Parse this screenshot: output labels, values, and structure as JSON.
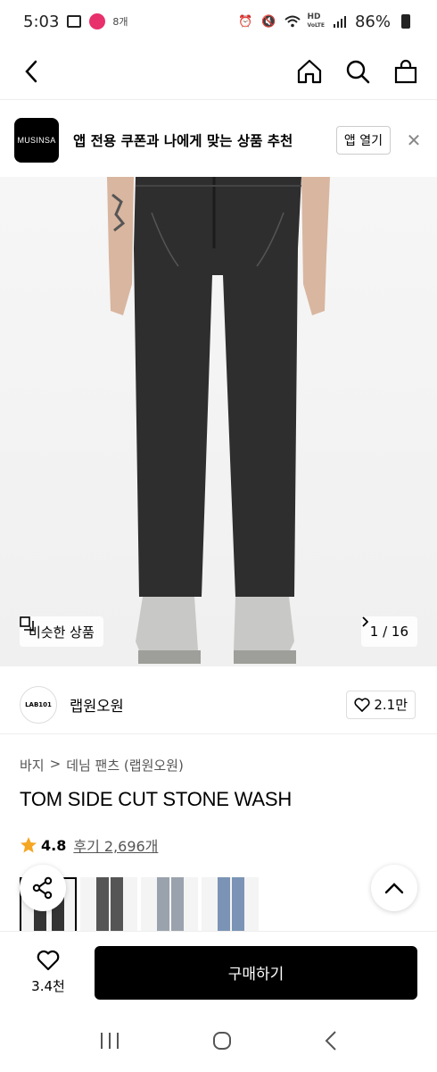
{
  "status": {
    "time": "5:03",
    "mini_label": "8개",
    "hd_label": "HD",
    "voice_label": "VoLTE",
    "battery": "86%"
  },
  "banner": {
    "logo_text": "MUSINSA",
    "message": "앱 전용 쿠폰과 나에게 맞는 상품 추천",
    "open_label": "앱 열기"
  },
  "image": {
    "similar_label": "비슷한 상품",
    "counter": "1 / 16"
  },
  "brand": {
    "logo_text": "LAB101",
    "name": "랩원오원",
    "likes": "2.1만"
  },
  "breadcrumb": [
    "바지",
    "데님 팬츠 (랩원오원)"
  ],
  "product": {
    "title": "TOM SIDE CUT STONE WASH",
    "rating": "4.8",
    "reviews": "후기 2,696개"
  },
  "thumbnails": [
    {
      "color": "#333333"
    },
    {
      "color": "#555555"
    },
    {
      "color": "#9aa3ad"
    },
    {
      "color": "#7b94b5"
    }
  ],
  "bottom": {
    "wish_count": "3.4천",
    "buy_label": "구매하기"
  },
  "colors": {
    "accent": "#000000",
    "star": "#f5a623"
  }
}
